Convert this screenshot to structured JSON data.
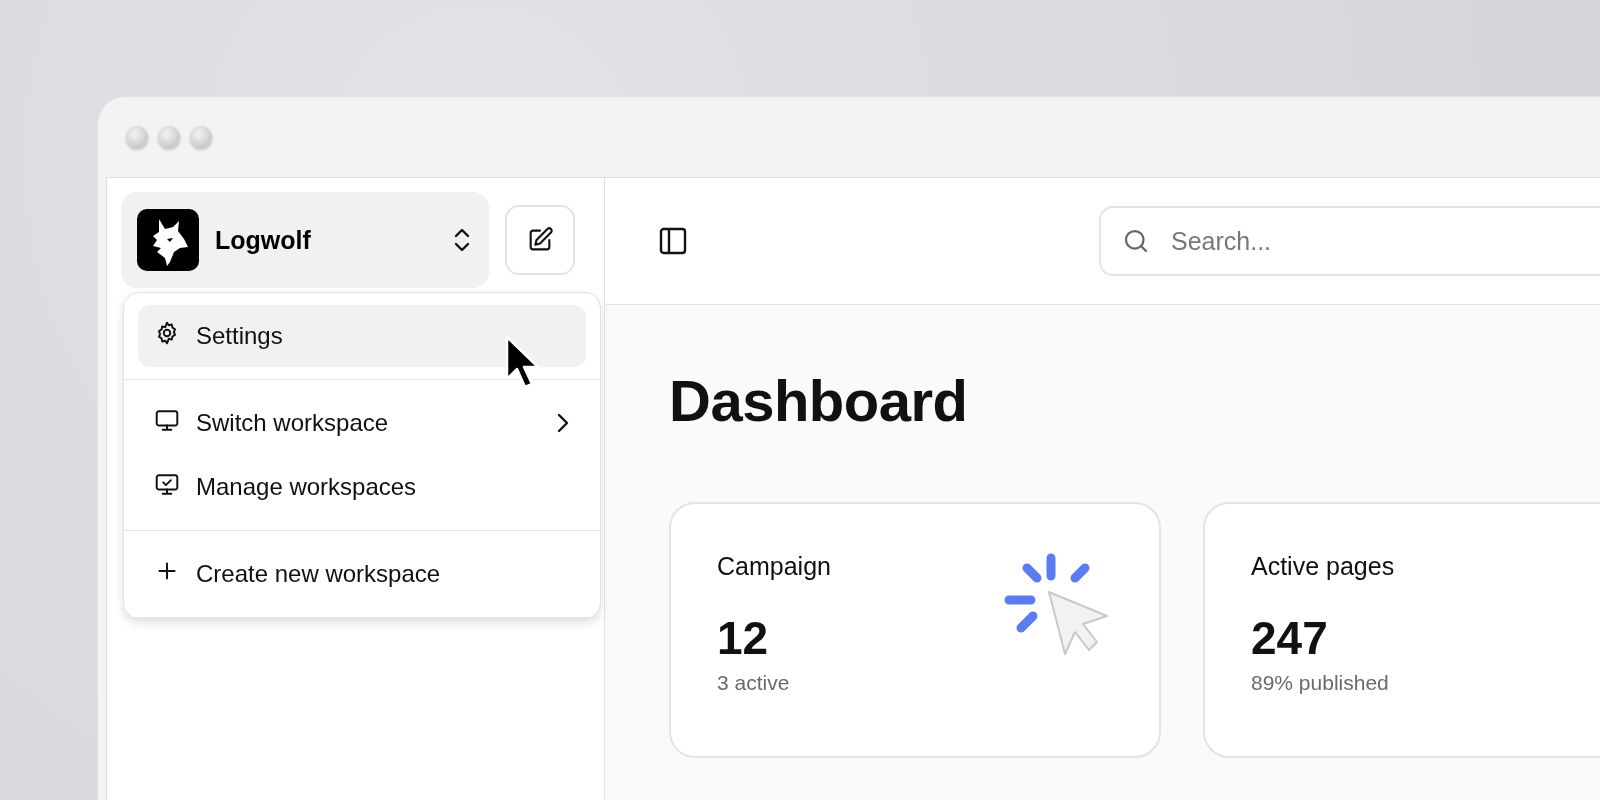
{
  "workspace": {
    "name": "Logwolf"
  },
  "menu": {
    "sections": [
      {
        "items": [
          {
            "kind": "settings",
            "label": "Settings",
            "submenu": false,
            "highlighted": true
          }
        ]
      },
      {
        "items": [
          {
            "kind": "switch",
            "label": "Switch workspace",
            "submenu": true,
            "highlighted": false
          },
          {
            "kind": "manage",
            "label": "Manage workspaces",
            "submenu": false,
            "highlighted": false
          }
        ]
      },
      {
        "items": [
          {
            "kind": "create",
            "label": "Create new workspace",
            "submenu": false,
            "highlighted": false
          }
        ]
      }
    ]
  },
  "search": {
    "placeholder": "Search..."
  },
  "page_title": "Dashboard",
  "cards": [
    {
      "kind": "clicks",
      "label": "Campaign",
      "value": "12",
      "sub": "3 active"
    },
    {
      "kind": "pages",
      "label": "Active pages",
      "value": "247",
      "sub": "89% published"
    }
  ]
}
